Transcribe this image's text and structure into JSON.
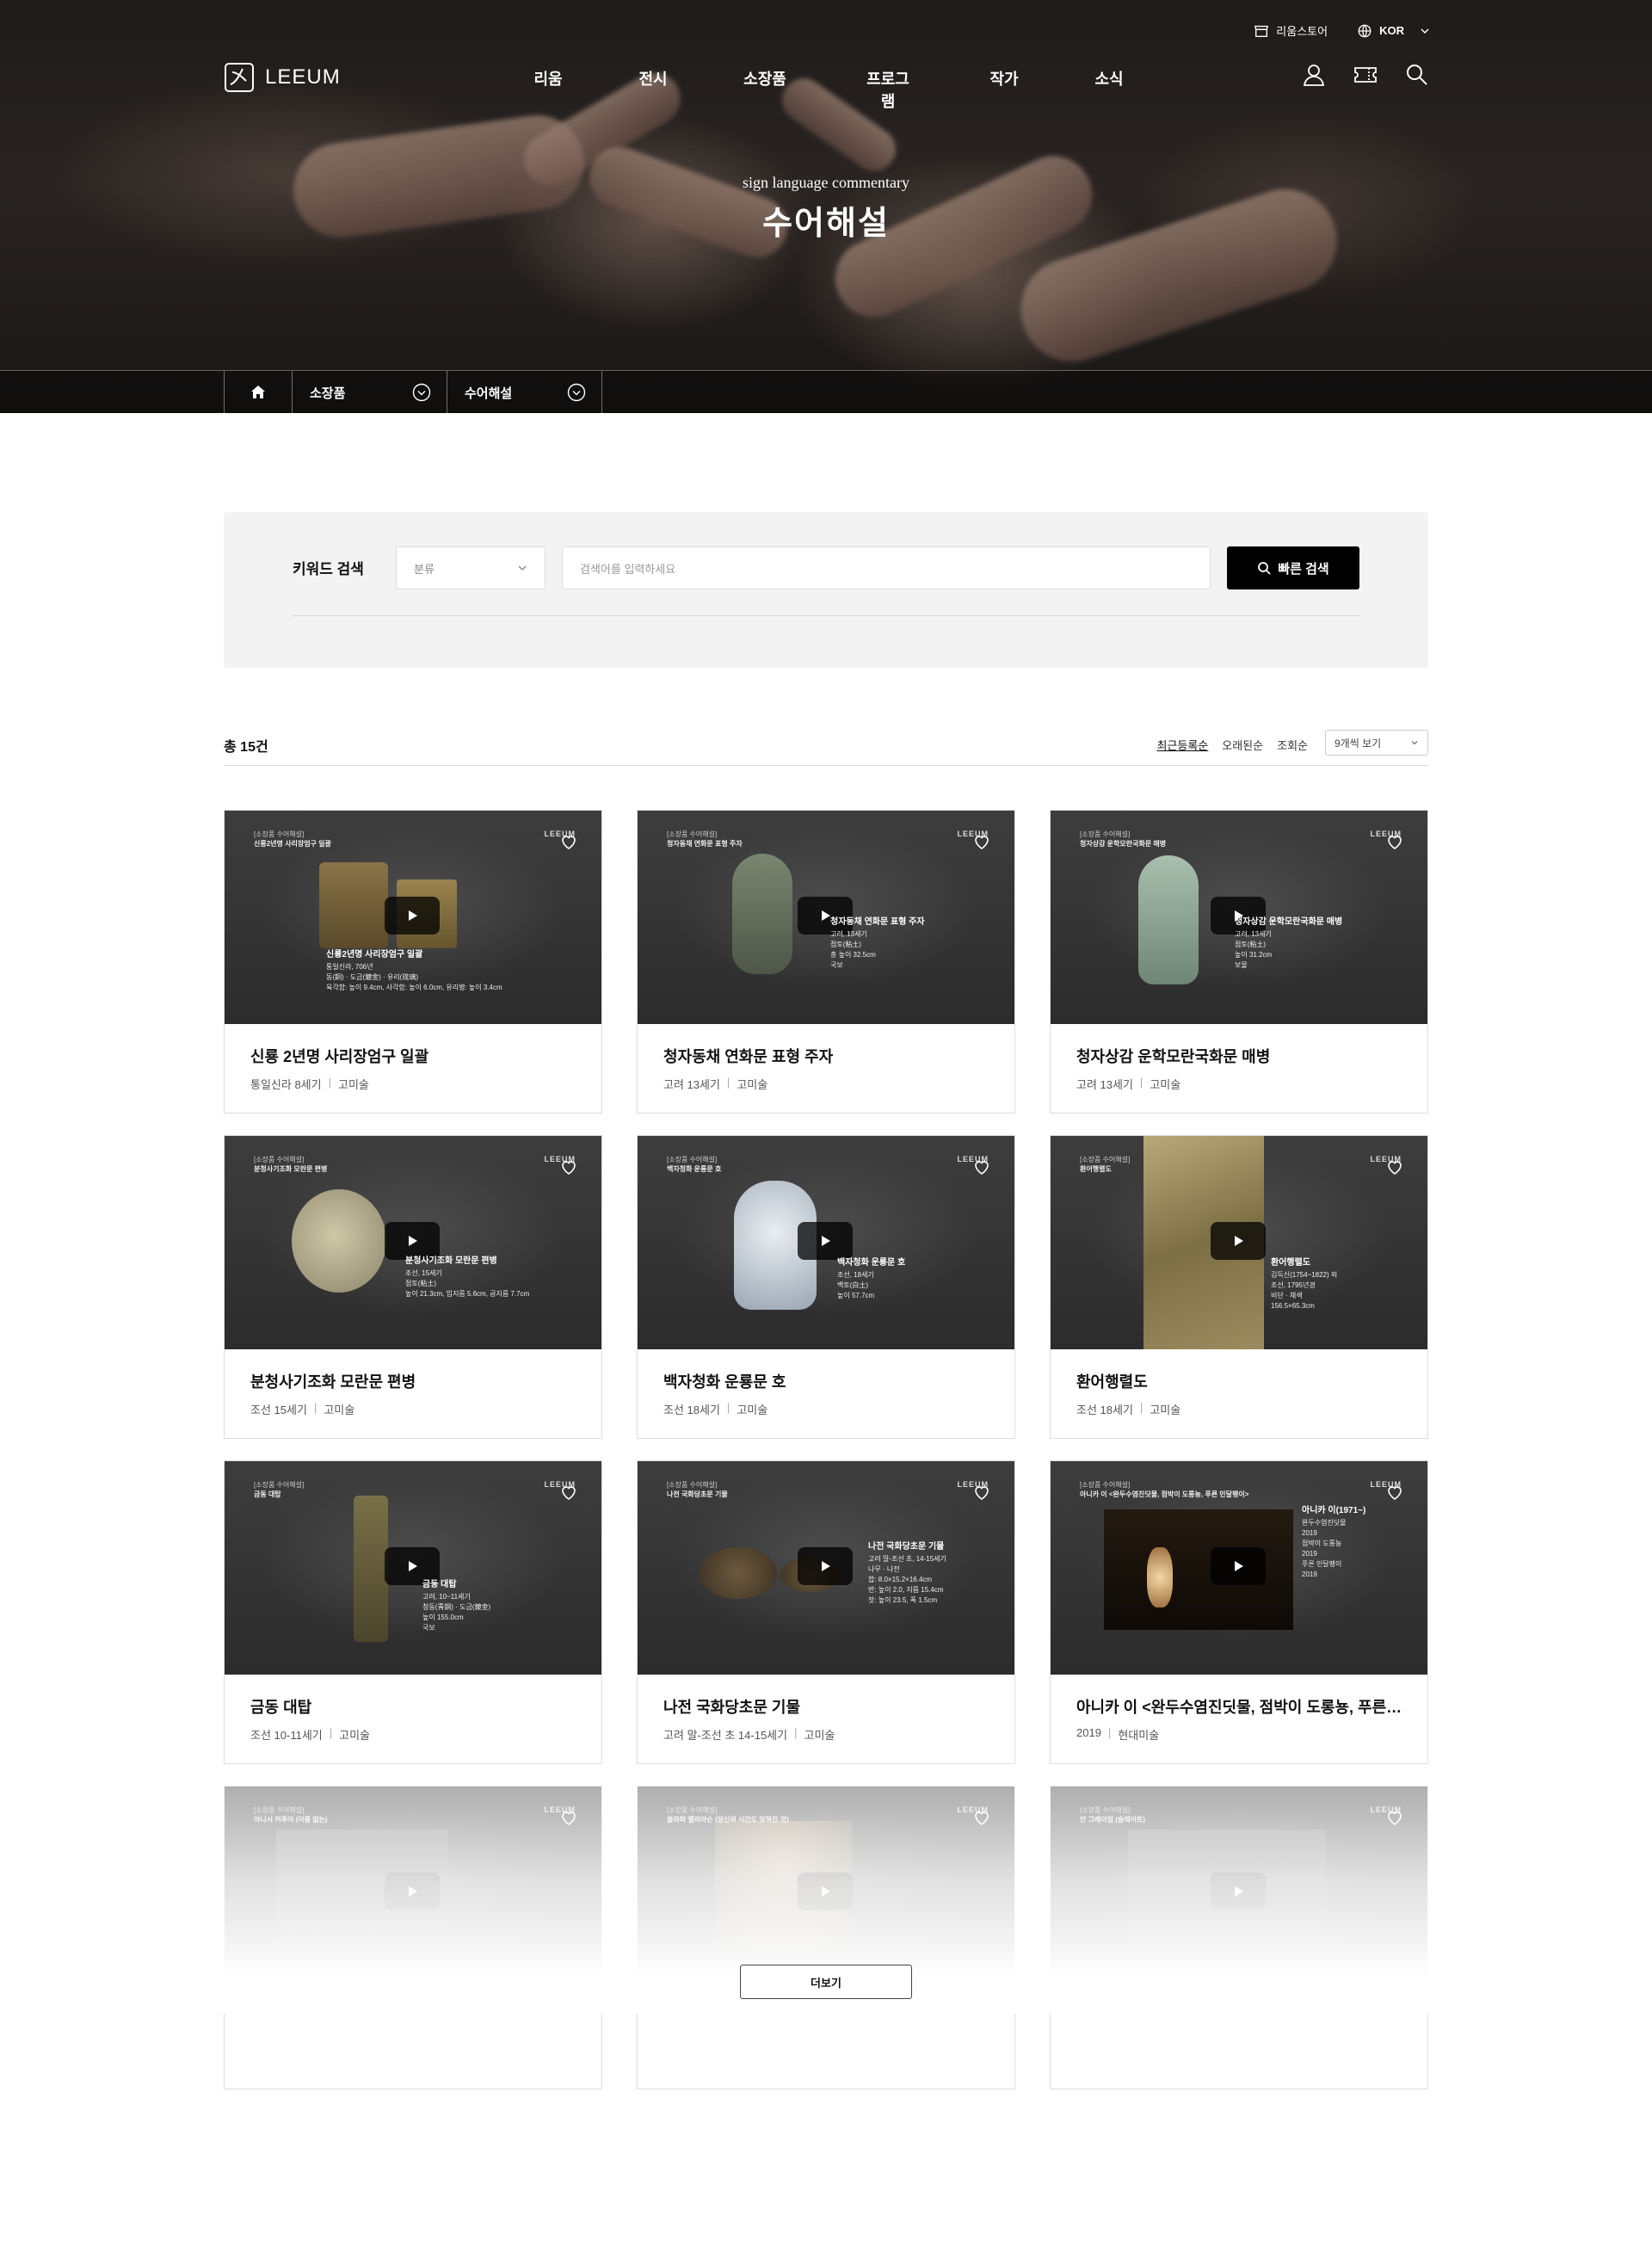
{
  "header": {
    "utility": [
      {
        "label": "리움스토어",
        "icon": "store-icon"
      },
      {
        "label": "KOR",
        "icon": "globe-icon"
      }
    ],
    "logo_text": "LEEUM",
    "nav": [
      "리움",
      "전시",
      "소장품",
      "프로그램",
      "작가",
      "소식"
    ]
  },
  "hero": {
    "subtitle": "sign language commentary",
    "title": "수어해설"
  },
  "breadcrumb": {
    "level1": "소장품",
    "level2": "수어해설"
  },
  "search": {
    "label": "키워드 검색",
    "category_placeholder": "분류",
    "input_placeholder": "검색어를 입력하세요",
    "button": "빠른 검색"
  },
  "list": {
    "total": "총 15건",
    "sorts": [
      "최근등록순",
      "오래된순",
      "조회순"
    ],
    "view": "9개씩 보기"
  },
  "cards": [
    {
      "tag": "[소장품 수어해설]",
      "tag_title": "신룡2년명 사리장엄구 일괄",
      "brand": "LEEUM",
      "cap_title": "신룡2년명 사리장엄구 일괄",
      "cap_lines": [
        "통일신라, 706년",
        "동(銅) · 도금(鍍金) · 유리(琉璃)",
        "육각함: 높이 9.4cm, 사각함: 높이 6.0cm, 유리병: 높이 3.4cm"
      ],
      "title": "신룡 2년명 사리장엄구 일괄",
      "period": "통일신라 8세기",
      "category": "고미술"
    },
    {
      "tag": "[소장품 수어해설]",
      "tag_title": "청자동채 연화문 표형 주자",
      "brand": "LEEUM",
      "cap_title": "청자동채 연화문 표형 주자",
      "cap_lines": [
        "고려, 13세기",
        "점토(粘土)",
        "총 높이 32.5cm",
        "국보"
      ],
      "title": "청자동채 연화문 표형 주자",
      "period": "고려 13세기",
      "category": "고미술"
    },
    {
      "tag": "[소장품 수어해설]",
      "tag_title": "청자상감 운학모란국화문 매병",
      "brand": "LEEUM",
      "cap_title": "청자상감 운학모란국화문 매병",
      "cap_lines": [
        "고려, 13세기",
        "점토(粘土)",
        "높이 31.2cm",
        "보물"
      ],
      "title": "청자상감 운학모란국화문 매병",
      "period": "고려 13세기",
      "category": "고미술"
    },
    {
      "tag": "[소장품 수어해설]",
      "tag_title": "분청사기조화 모란문 편병",
      "brand": "LEEUM",
      "cap_title": "분청사기조화 모란문 편병",
      "cap_lines": [
        "조선, 15세기",
        "점토(粘土)",
        "높이 21.3cm, 입지름 5.6cm, 굽지름 7.7cm"
      ],
      "title": "분청사기조화 모란문 편병",
      "period": "조선 15세기",
      "category": "고미술"
    },
    {
      "tag": "[소장품 수어해설]",
      "tag_title": "백자청화 운룡문 호",
      "brand": "LEEUM",
      "cap_title": "백자청화 운룡문 호",
      "cap_lines": [
        "조선, 18세기",
        "백토(白土)",
        "높이 57.7cm"
      ],
      "title": "백자청화 운룡문 호",
      "period": "조선 18세기",
      "category": "고미술"
    },
    {
      "tag": "[소장품 수어해설]",
      "tag_title": "환어행렬도",
      "brand": "LEEUM",
      "cap_title": "환어행렬도",
      "cap_lines": [
        "김득신(1754~1822) 외",
        "조선, 1795년경",
        "비단 · 채색",
        "156.5×65.3cm"
      ],
      "title": "환어행렬도",
      "period": "조선 18세기",
      "category": "고미술"
    },
    {
      "tag": "[소장품 수어해설]",
      "tag_title": "금동 대탑",
      "brand": "LEEUM",
      "cap_title": "금동 대탑",
      "cap_lines": [
        "고려, 10~11세기",
        "청동(靑銅) · 도금(鍍金)",
        "높이 155.0cm",
        "국보"
      ],
      "title": "금동 대탑",
      "period": "조선 10-11세기",
      "category": "고미술"
    },
    {
      "tag": "[소장품 수어해설]",
      "tag_title": "나전 국화당초문 기물",
      "brand": "LEEUM",
      "cap_title": "나전 국화당초문 기물",
      "cap_lines": [
        "고려 말-조선 초, 14-15세기",
        "나무 · 나전",
        "합: 8.0×15.2×16.4cm",
        "반: 높이 2.0, 지름 15.4cm",
        "잣: 높이 23.5, 폭 1.5cm"
      ],
      "title": "나전 국화당초문 기물",
      "period": "고려 말-조선 초 14-15세기",
      "category": "고미술"
    },
    {
      "tag": "[소장품 수어해설]",
      "tag_title": "아니카 이 <완두수염진딧물, 점박이 도롱뇽, 푸른 민달팽이>",
      "brand": "LEEUM",
      "cap_title": "아니카 이(1971~)",
      "cap_lines": [
        "완두수염진딧물",
        "2019",
        "점박이 도롱뇽",
        "2019",
        "푸른 민달팽이",
        "2019"
      ],
      "title": "아니카 이 <완두수염진딧물, 점박이 도롱뇽, 푸른 민달팽이>",
      "period": "2019",
      "category": "현대미술"
    },
    {
      "tag": "[소장품 수어해설]",
      "tag_title": "아니시 커푸어 (이름 없는)",
      "brand": "LEEUM",
      "cap_title": "",
      "cap_lines": [],
      "title": "",
      "period": "",
      "category": ""
    },
    {
      "tag": "[소장품 수어해설]",
      "tag_title": "올라퍼 엘리아슨 (당신의 시간도 잊혀진 것)",
      "brand": "LEEUM",
      "cap_title": "",
      "cap_lines": [],
      "title": "",
      "period": "",
      "category": ""
    },
    {
      "tag": "[소장품 수어해설]",
      "tag_title": "안 그레이엄 (슬레이트)",
      "brand": "LEEUM",
      "cap_title": "",
      "cap_lines": [],
      "title": "",
      "period": "",
      "category": ""
    }
  ],
  "more_button": "더보기"
}
